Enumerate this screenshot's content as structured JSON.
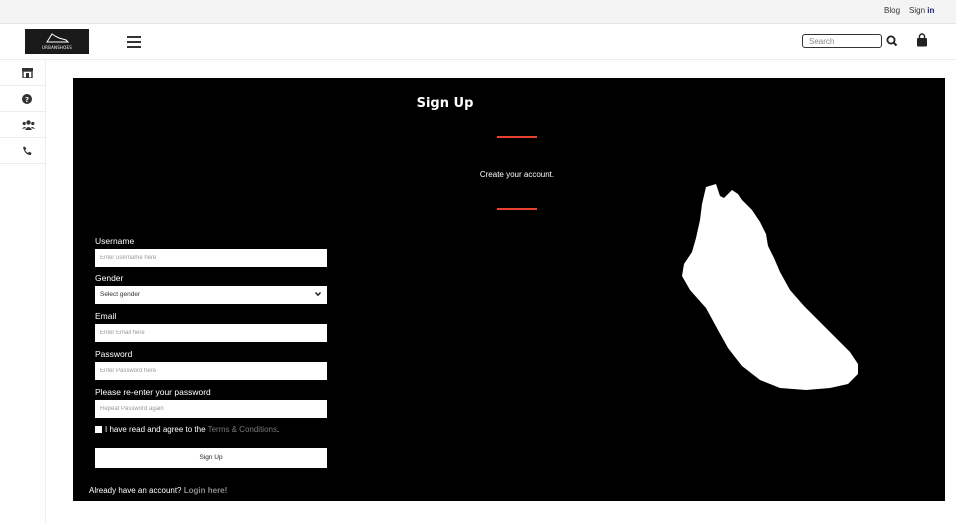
{
  "topbar": {
    "blog": "Blog",
    "signin_prefix": "Sign ",
    "signin_bold": "in"
  },
  "header": {
    "logo_text": "URBANSHOES",
    "search_placeholder": "Search",
    "icons": [
      "menu-icon",
      "search-icon",
      "shopping-bag-icon"
    ]
  },
  "sidebar": {
    "items": [
      {
        "icon": "store-icon"
      },
      {
        "icon": "help-icon"
      },
      {
        "icon": "users-icon"
      },
      {
        "icon": "phone-icon"
      }
    ]
  },
  "form": {
    "title": "Sign Up",
    "subtitle": "Create your account.",
    "username_label": "Username",
    "username_placeholder": "Enter username here",
    "gender_label": "Gender",
    "gender_selected": "Select gender",
    "email_label": "Email",
    "email_placeholder": "Enter Email here",
    "password_label": "Password",
    "password_placeholder": "Enter Password here",
    "repassword_label": "Please re-enter your password",
    "repassword_placeholder": "Repeat Password again",
    "terms_text": "I have read and agree to the ",
    "terms_link": "Terms & Conditions",
    "terms_end": ".",
    "submit_label": "Sign Up",
    "already_text": "Already have an account? ",
    "login_link": "Login here!"
  },
  "colors": {
    "accent": "#e8432e",
    "card_bg": "#000000",
    "muted_link": "#8d8d8d"
  }
}
